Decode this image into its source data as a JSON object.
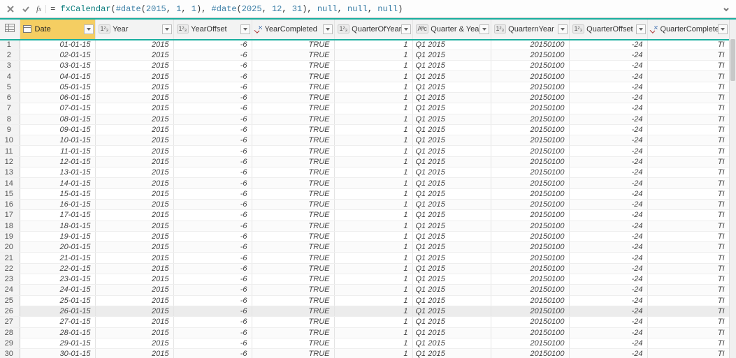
{
  "formula": {
    "raw": "= fxCalendar(#date(2015, 1, 1), #date(2025, 12, 31), null, null, null)",
    "tokens": [
      {
        "t": "= ",
        "c": "kw"
      },
      {
        "t": "fxCalendar",
        "c": "fn"
      },
      {
        "t": "(",
        "c": "kw"
      },
      {
        "t": "#date",
        "c": "hash"
      },
      {
        "t": "(",
        "c": "kw"
      },
      {
        "t": "2015",
        "c": "num"
      },
      {
        "t": ", ",
        "c": "kw"
      },
      {
        "t": "1",
        "c": "num"
      },
      {
        "t": ", ",
        "c": "kw"
      },
      {
        "t": "1",
        "c": "num"
      },
      {
        "t": "), ",
        "c": "kw"
      },
      {
        "t": "#date",
        "c": "hash"
      },
      {
        "t": "(",
        "c": "kw"
      },
      {
        "t": "2025",
        "c": "num"
      },
      {
        "t": ", ",
        "c": "kw"
      },
      {
        "t": "12",
        "c": "num"
      },
      {
        "t": ", ",
        "c": "kw"
      },
      {
        "t": "31",
        "c": "num"
      },
      {
        "t": "), ",
        "c": "kw"
      },
      {
        "t": "null",
        "c": "null"
      },
      {
        "t": ", ",
        "c": "kw"
      },
      {
        "t": "null",
        "c": "null"
      },
      {
        "t": ", ",
        "c": "kw"
      },
      {
        "t": "null",
        "c": "null"
      },
      {
        "t": ")",
        "c": "kw"
      }
    ]
  },
  "columns": [
    {
      "key": "rownum",
      "label": "",
      "type": "corner"
    },
    {
      "key": "Date",
      "label": "Date",
      "type": "date",
      "highlight": true
    },
    {
      "key": "Year",
      "label": "Year",
      "type": "int"
    },
    {
      "key": "YearOffset",
      "label": "YearOffset",
      "type": "int"
    },
    {
      "key": "YearCompleted",
      "label": "YearCompleted",
      "type": "bool"
    },
    {
      "key": "QuarterOfYear",
      "label": "QuarterOfYear",
      "type": "int"
    },
    {
      "key": "QuarterAndYear",
      "label": "Quarter & Year",
      "type": "text"
    },
    {
      "key": "QuarternYear",
      "label": "QuarternYear",
      "type": "int"
    },
    {
      "key": "QuarterOffset",
      "label": "QuarterOffset",
      "type": "int"
    },
    {
      "key": "QuarterCompleted",
      "label": "QuarterCompleted",
      "type": "bool"
    }
  ],
  "type_labels": {
    "int": "1²₃",
    "text": "Aᴮc",
    "bool": "bool",
    "date": "cal"
  },
  "row_template": {
    "Year": "2015",
    "YearOffset": "-6",
    "YearCompleted": "TRUE",
    "QuarterOfYear": "1",
    "QuarterAndYear": "Q1 2015",
    "QuarternYear": "20150100",
    "QuarterOffset": "-24",
    "QuarterCompleted": "TI"
  },
  "dates": [
    "01-01-15",
    "02-01-15",
    "03-01-15",
    "04-01-15",
    "05-01-15",
    "06-01-15",
    "07-01-15",
    "08-01-15",
    "09-01-15",
    "10-01-15",
    "11-01-15",
    "12-01-15",
    "13-01-15",
    "14-01-15",
    "15-01-15",
    "16-01-15",
    "17-01-15",
    "18-01-15",
    "19-01-15",
    "20-01-15",
    "21-01-15",
    "22-01-15",
    "23-01-15",
    "24-01-15",
    "25-01-15",
    "26-01-15",
    "27-01-15",
    "28-01-15",
    "29-01-15",
    "30-01-15"
  ],
  "selected_row": 26,
  "aligns": {
    "Date": "right",
    "Year": "right",
    "YearOffset": "right",
    "YearCompleted": "right",
    "QuarterOfYear": "right",
    "QuarterAndYear": "left",
    "QuarternYear": "right",
    "QuarterOffset": "right",
    "QuarterCompleted": "right"
  }
}
